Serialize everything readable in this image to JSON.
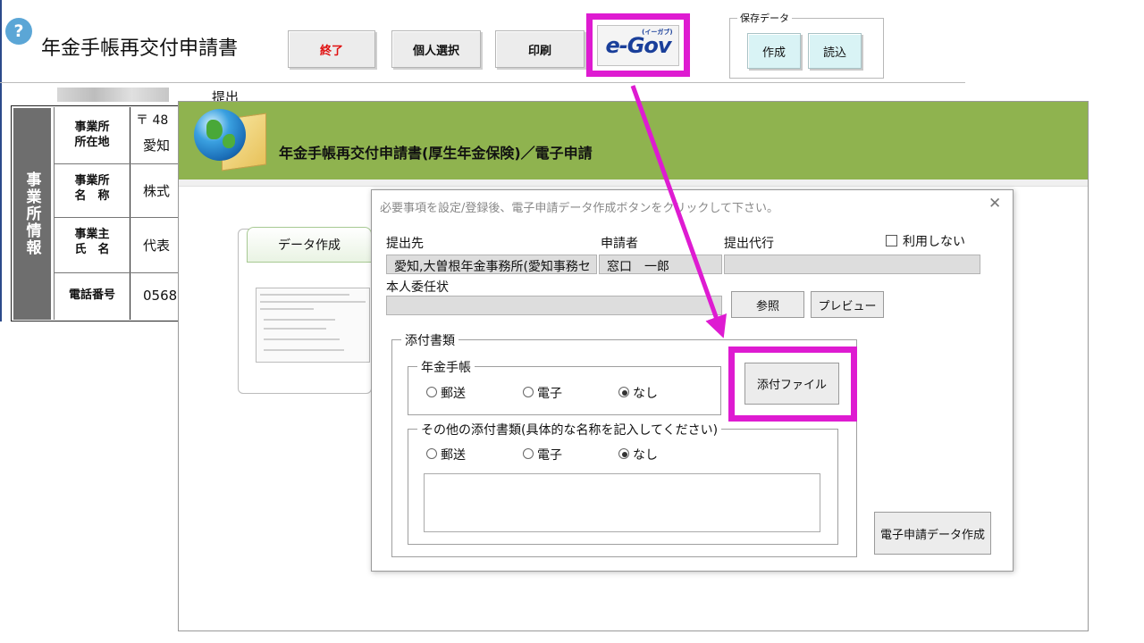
{
  "header": {
    "help_icon": "?",
    "title": "年金手帳再交付申請書",
    "buttons": {
      "exit": "終了",
      "select_person": "個人選択",
      "print": "印刷"
    },
    "egov": {
      "logo": "e-Gov",
      "kana": "(イーガブ)"
    },
    "saved_data": {
      "legend": "保存データ",
      "create": "作成",
      "load": "読込"
    }
  },
  "sheet": {
    "submit_label": "提出",
    "side_header": "事業所情報",
    "rows": [
      {
        "label_l1": "事業所",
        "label_l2": "所在地",
        "value": "愛知"
      },
      {
        "label_l1": "事業所",
        "label_l2": "名　称",
        "value": "株式"
      },
      {
        "label_l1": "事業主",
        "label_l2": "氏　名",
        "value": "代表"
      },
      {
        "label_l1": "電話番号",
        "label_l2": "",
        "value": "0568"
      }
    ],
    "postal_fragment": "〒 48"
  },
  "window": {
    "title": "年金手帳再交付申請書(厚生年金保険)／電子申請",
    "tab_data_create": "データ作成"
  },
  "dialog": {
    "instruction": "必要事項を設定/登録後、電子申請データ作成ボタンをクリックして下さい。",
    "close": "✕",
    "fields": {
      "submit_to_label": "提出先",
      "submit_to_value": "愛知,大曽根年金事務所(愛知事務セ",
      "applicant_label": "申請者",
      "applicant_value": "窓口　一郎",
      "agent_label": "提出代行",
      "agent_value": ""
    },
    "not_use_label": "利用しない",
    "proxy_label": "本人委任状",
    "browse": "参照",
    "preview": "プレビュー",
    "attachments_legend": "添付書類",
    "pension_book_legend": "年金手帳",
    "other_legend": "その他の添付書類(具体的な名称を記入してください)",
    "radio_options": [
      "郵送",
      "電子",
      "なし"
    ],
    "pension_selected": "なし",
    "other_selected": "なし",
    "attach_file": "添付ファイル",
    "create_data": "電子申請データ作成"
  },
  "colors": {
    "highlight": "#de1bd1",
    "header_green": "#8fb34f",
    "exit_red": "#e01010"
  }
}
